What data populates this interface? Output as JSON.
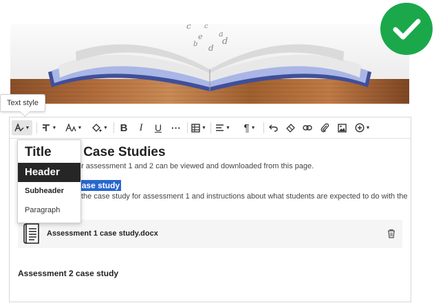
{
  "tooltip": {
    "text": "Text style"
  },
  "banner": {
    "letters": [
      "c",
      "e",
      "a",
      "d",
      "b",
      "d",
      "c"
    ]
  },
  "toolbar": {
    "buttons": [
      {
        "name": "text-style",
        "icon": "text-style-icon"
      },
      {
        "name": "font-format",
        "icon": "text-format-icon"
      },
      {
        "name": "font-size",
        "icon": "font-size-icon"
      },
      {
        "name": "text-color",
        "icon": "paint-bucket-icon"
      },
      {
        "name": "bold",
        "icon": "bold-icon"
      },
      {
        "name": "italic",
        "icon": "italic-icon"
      },
      {
        "name": "underline",
        "icon": "underline-icon"
      },
      {
        "name": "more",
        "icon": "more-icon"
      },
      {
        "name": "table",
        "icon": "table-icon"
      },
      {
        "name": "align",
        "icon": "align-icon"
      },
      {
        "name": "paragraph",
        "icon": "pilcrow-icon"
      },
      {
        "name": "undo",
        "icon": "undo-icon"
      },
      {
        "name": "clear-format",
        "icon": "eraser-icon"
      },
      {
        "name": "link",
        "icon": "link-icon"
      },
      {
        "name": "attach",
        "icon": "paperclip-icon"
      },
      {
        "name": "image",
        "icon": "image-icon"
      },
      {
        "name": "insert",
        "icon": "plus-circle-icon"
      }
    ]
  },
  "content": {
    "title_visible": "nt Case Studies",
    "para1_visible": "r assessment 1 and 2 can be viewed and downloaded from this page.",
    "selected_heading_visible": "ase study",
    "para2_visible": "the case study for assessment 1 and instructions about what students are expected to do with the",
    "para2_tail": "",
    "file_name": "Assessment 1 case study.docx",
    "heading2": "Assessment 2 case study"
  },
  "dropdown": {
    "items": [
      "Title",
      "Header",
      "Subheader",
      "Paragraph"
    ],
    "selected": "Header"
  },
  "colors": {
    "check": "#1aa84b",
    "selection": "#2866d1",
    "dropdown_selected": "#262626"
  }
}
